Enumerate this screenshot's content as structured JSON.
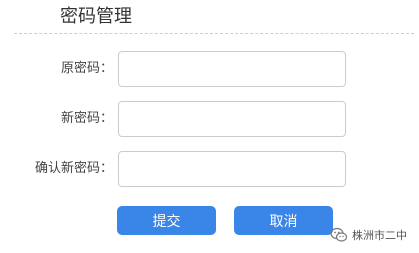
{
  "header": {
    "title": "密码管理"
  },
  "form": {
    "fields": [
      {
        "label": "原密码：",
        "value": ""
      },
      {
        "label": "新密码：",
        "value": ""
      },
      {
        "label": "确认新密码：",
        "value": ""
      }
    ],
    "submit_label": "提交",
    "cancel_label": "取消"
  },
  "watermark": {
    "text": "株洲市二中",
    "icon": "wechat-icon"
  },
  "colors": {
    "accent": "#3a86e8",
    "border": "#cccccc"
  }
}
